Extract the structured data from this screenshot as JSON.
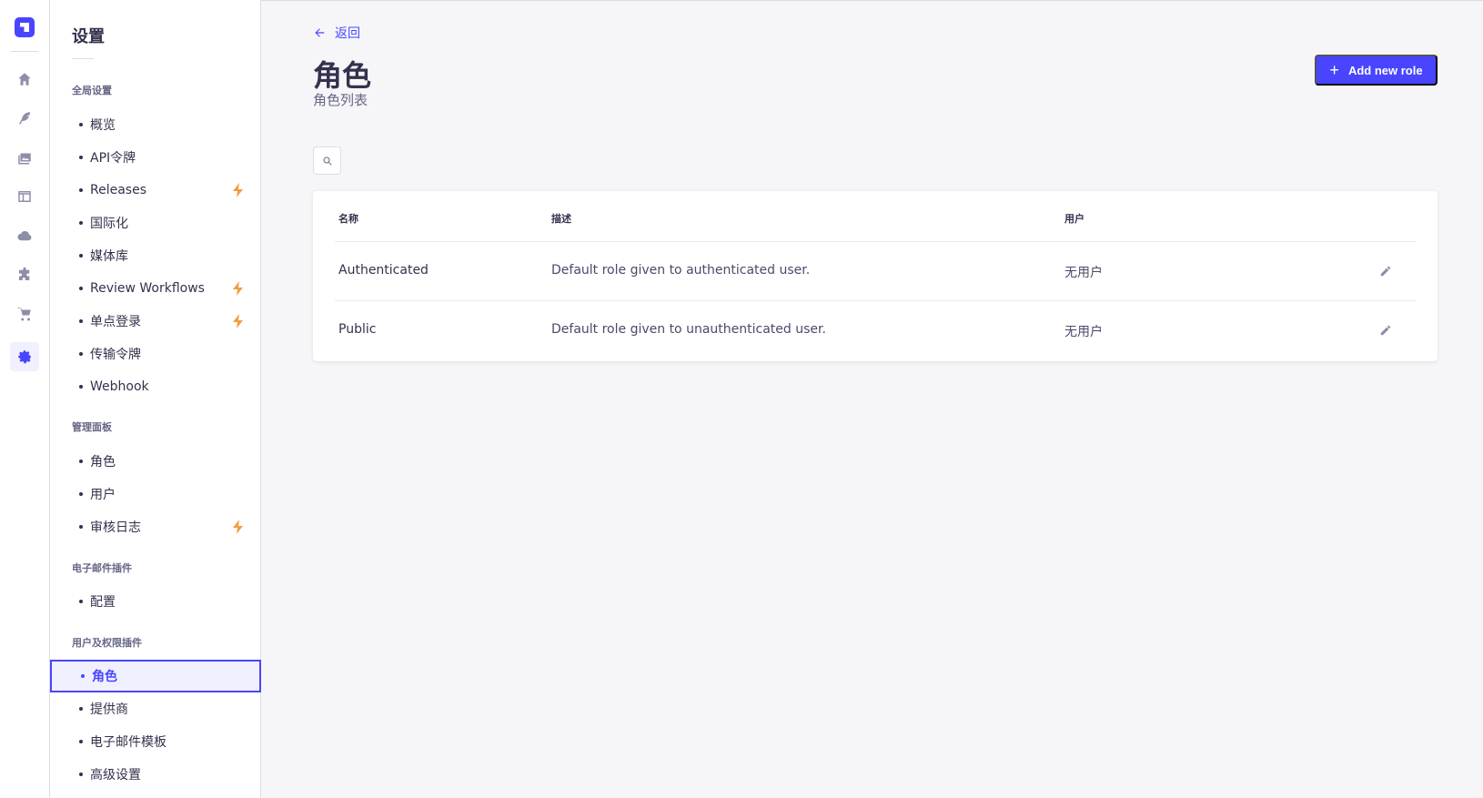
{
  "settings": {
    "title": "设置",
    "sections": [
      {
        "title": "全局设置",
        "items": [
          {
            "label": "概览"
          },
          {
            "label": "API令牌"
          },
          {
            "label": "Releases",
            "badge": "bolt"
          },
          {
            "label": "国际化"
          },
          {
            "label": "媒体库"
          },
          {
            "label": "Review Workflows",
            "badge": "bolt"
          },
          {
            "label": "单点登录",
            "badge": "bolt"
          },
          {
            "label": "传输令牌"
          },
          {
            "label": "Webhook"
          }
        ]
      },
      {
        "title": "管理面板",
        "items": [
          {
            "label": "角色"
          },
          {
            "label": "用户"
          },
          {
            "label": "审核日志",
            "badge": "bolt"
          }
        ]
      },
      {
        "title": "电子邮件插件",
        "items": [
          {
            "label": "配置"
          }
        ]
      },
      {
        "title": "用户及权限插件",
        "items": [
          {
            "label": "角色",
            "active": true
          },
          {
            "label": "提供商"
          },
          {
            "label": "电子邮件模板"
          },
          {
            "label": "高级设置"
          }
        ]
      }
    ]
  },
  "header": {
    "back_label": "返回",
    "title": "角色",
    "subtitle": "角色列表",
    "add_button_label": "Add new role"
  },
  "table": {
    "columns": [
      "名称",
      "描述",
      "用户"
    ],
    "rows": [
      {
        "name": "Authenticated",
        "description": "Default role given to authenticated user.",
        "users": "无用户"
      },
      {
        "name": "Public",
        "description": "Default role given to unauthenticated user.",
        "users": "无用户"
      }
    ]
  },
  "colors": {
    "primary": "#4945ff",
    "bolt": "#f29d41",
    "background": "#f6f6f9"
  },
  "icons": {
    "rail": [
      "home-icon",
      "feather-icon",
      "media-icon",
      "layout-icon",
      "cloud-icon",
      "puzzle-icon",
      "cart-icon",
      "gear-icon"
    ]
  }
}
